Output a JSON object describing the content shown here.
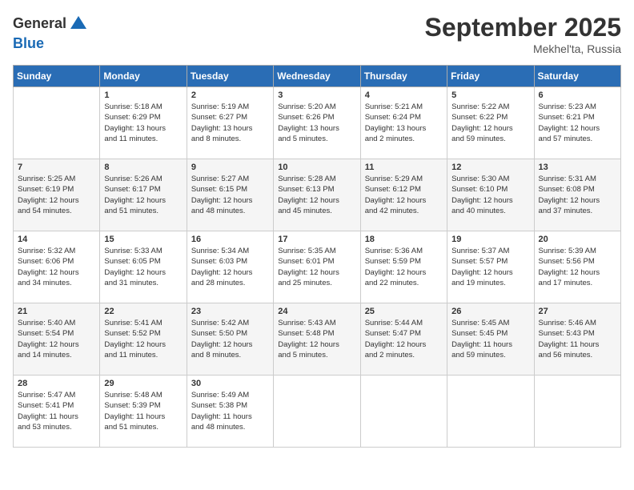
{
  "header": {
    "logo_line1": "General",
    "logo_line2": "Blue",
    "month_year": "September 2025",
    "location": "Mekhel'ta, Russia"
  },
  "days_of_week": [
    "Sunday",
    "Monday",
    "Tuesday",
    "Wednesday",
    "Thursday",
    "Friday",
    "Saturday"
  ],
  "weeks": [
    [
      {
        "day": "",
        "info": ""
      },
      {
        "day": "1",
        "info": "Sunrise: 5:18 AM\nSunset: 6:29 PM\nDaylight: 13 hours\nand 11 minutes."
      },
      {
        "day": "2",
        "info": "Sunrise: 5:19 AM\nSunset: 6:27 PM\nDaylight: 13 hours\nand 8 minutes."
      },
      {
        "day": "3",
        "info": "Sunrise: 5:20 AM\nSunset: 6:26 PM\nDaylight: 13 hours\nand 5 minutes."
      },
      {
        "day": "4",
        "info": "Sunrise: 5:21 AM\nSunset: 6:24 PM\nDaylight: 13 hours\nand 2 minutes."
      },
      {
        "day": "5",
        "info": "Sunrise: 5:22 AM\nSunset: 6:22 PM\nDaylight: 12 hours\nand 59 minutes."
      },
      {
        "day": "6",
        "info": "Sunrise: 5:23 AM\nSunset: 6:21 PM\nDaylight: 12 hours\nand 57 minutes."
      }
    ],
    [
      {
        "day": "7",
        "info": "Sunrise: 5:25 AM\nSunset: 6:19 PM\nDaylight: 12 hours\nand 54 minutes."
      },
      {
        "day": "8",
        "info": "Sunrise: 5:26 AM\nSunset: 6:17 PM\nDaylight: 12 hours\nand 51 minutes."
      },
      {
        "day": "9",
        "info": "Sunrise: 5:27 AM\nSunset: 6:15 PM\nDaylight: 12 hours\nand 48 minutes."
      },
      {
        "day": "10",
        "info": "Sunrise: 5:28 AM\nSunset: 6:13 PM\nDaylight: 12 hours\nand 45 minutes."
      },
      {
        "day": "11",
        "info": "Sunrise: 5:29 AM\nSunset: 6:12 PM\nDaylight: 12 hours\nand 42 minutes."
      },
      {
        "day": "12",
        "info": "Sunrise: 5:30 AM\nSunset: 6:10 PM\nDaylight: 12 hours\nand 40 minutes."
      },
      {
        "day": "13",
        "info": "Sunrise: 5:31 AM\nSunset: 6:08 PM\nDaylight: 12 hours\nand 37 minutes."
      }
    ],
    [
      {
        "day": "14",
        "info": "Sunrise: 5:32 AM\nSunset: 6:06 PM\nDaylight: 12 hours\nand 34 minutes."
      },
      {
        "day": "15",
        "info": "Sunrise: 5:33 AM\nSunset: 6:05 PM\nDaylight: 12 hours\nand 31 minutes."
      },
      {
        "day": "16",
        "info": "Sunrise: 5:34 AM\nSunset: 6:03 PM\nDaylight: 12 hours\nand 28 minutes."
      },
      {
        "day": "17",
        "info": "Sunrise: 5:35 AM\nSunset: 6:01 PM\nDaylight: 12 hours\nand 25 minutes."
      },
      {
        "day": "18",
        "info": "Sunrise: 5:36 AM\nSunset: 5:59 PM\nDaylight: 12 hours\nand 22 minutes."
      },
      {
        "day": "19",
        "info": "Sunrise: 5:37 AM\nSunset: 5:57 PM\nDaylight: 12 hours\nand 19 minutes."
      },
      {
        "day": "20",
        "info": "Sunrise: 5:39 AM\nSunset: 5:56 PM\nDaylight: 12 hours\nand 17 minutes."
      }
    ],
    [
      {
        "day": "21",
        "info": "Sunrise: 5:40 AM\nSunset: 5:54 PM\nDaylight: 12 hours\nand 14 minutes."
      },
      {
        "day": "22",
        "info": "Sunrise: 5:41 AM\nSunset: 5:52 PM\nDaylight: 12 hours\nand 11 minutes."
      },
      {
        "day": "23",
        "info": "Sunrise: 5:42 AM\nSunset: 5:50 PM\nDaylight: 12 hours\nand 8 minutes."
      },
      {
        "day": "24",
        "info": "Sunrise: 5:43 AM\nSunset: 5:48 PM\nDaylight: 12 hours\nand 5 minutes."
      },
      {
        "day": "25",
        "info": "Sunrise: 5:44 AM\nSunset: 5:47 PM\nDaylight: 12 hours\nand 2 minutes."
      },
      {
        "day": "26",
        "info": "Sunrise: 5:45 AM\nSunset: 5:45 PM\nDaylight: 11 hours\nand 59 minutes."
      },
      {
        "day": "27",
        "info": "Sunrise: 5:46 AM\nSunset: 5:43 PM\nDaylight: 11 hours\nand 56 minutes."
      }
    ],
    [
      {
        "day": "28",
        "info": "Sunrise: 5:47 AM\nSunset: 5:41 PM\nDaylight: 11 hours\nand 53 minutes."
      },
      {
        "day": "29",
        "info": "Sunrise: 5:48 AM\nSunset: 5:39 PM\nDaylight: 11 hours\nand 51 minutes."
      },
      {
        "day": "30",
        "info": "Sunrise: 5:49 AM\nSunset: 5:38 PM\nDaylight: 11 hours\nand 48 minutes."
      },
      {
        "day": "",
        "info": ""
      },
      {
        "day": "",
        "info": ""
      },
      {
        "day": "",
        "info": ""
      },
      {
        "day": "",
        "info": ""
      }
    ]
  ]
}
